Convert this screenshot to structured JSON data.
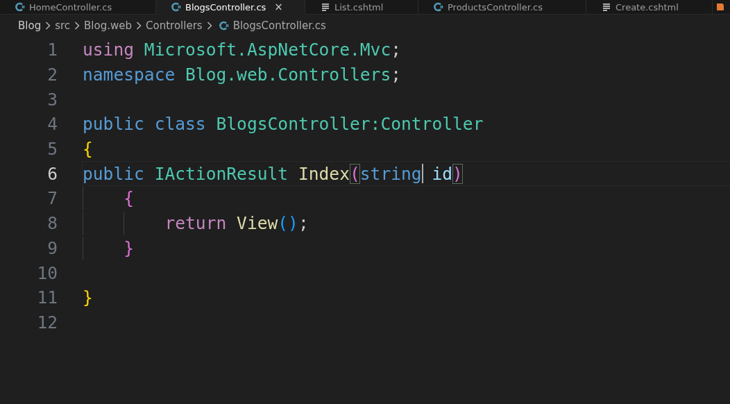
{
  "tabs": [
    {
      "label": "HomeController.cs",
      "kind": "csharp",
      "selected": false
    },
    {
      "label": "BlogsController.cs",
      "kind": "csharp",
      "selected": true,
      "close": "×"
    },
    {
      "label": "List.cshtml",
      "kind": "markup",
      "selected": false
    },
    {
      "label": "ProductsController.cs",
      "kind": "csharp",
      "selected": false
    },
    {
      "label": "Create.cshtml",
      "kind": "markup",
      "selected": false
    },
    {
      "kind": "other",
      "selected": false
    }
  ],
  "breadcrumb": [
    {
      "label": "Blog",
      "kind": "folder"
    },
    {
      "label": "src",
      "kind": "folder"
    },
    {
      "label": "Blog.web",
      "kind": "folder"
    },
    {
      "label": "Controllers",
      "kind": "folder"
    },
    {
      "label": "BlogsController.cs",
      "kind": "csharp"
    }
  ],
  "lines": [
    {
      "number": "1",
      "current": false,
      "tokens": [
        {
          "kind": "control",
          "text": "using"
        },
        {
          "kind": "type",
          "text": "Microsoft.AspNetCore.Mvc",
          "space": true
        },
        {
          "kind": "plain",
          "text": ";"
        }
      ]
    },
    {
      "number": "2",
      "current": false,
      "tokens": [
        {
          "kind": "keyword",
          "text": "namespace"
        },
        {
          "kind": "type",
          "text": "Blog.web.Controllers",
          "space": true
        },
        {
          "kind": "plain",
          "text": ";"
        }
      ]
    },
    {
      "number": "3",
      "current": false
    },
    {
      "number": "4",
      "current": false,
      "tokens": [
        {
          "kind": "keyword",
          "text": "public class"
        },
        {
          "kind": "type",
          "text": "BlogsController:Controller",
          "space": true
        }
      ]
    },
    {
      "number": "5",
      "current": false,
      "tokens": [
        {
          "kind": "bracket1",
          "text": "{"
        }
      ]
    },
    {
      "number": "6",
      "current": true,
      "tokens": [
        {
          "kind": "keyword",
          "text": "public"
        },
        {
          "kind": "type",
          "text": "IActionResult",
          "space": true
        },
        {
          "kind": "function",
          "text": "Index",
          "space": true
        },
        {
          "kind": "bracket2",
          "text": "(",
          "matched": true
        },
        {
          "kind": "keyword",
          "text": "string",
          "cursor_after": true
        },
        {
          "kind": "param",
          "text": "id",
          "space": true
        },
        {
          "kind": "bracket2",
          "text": ")",
          "matched": true
        }
      ],
      "children": [
        {
          "number": "7",
          "current": false,
          "tokens": [
            {
              "kind": "bracket2",
              "text": "{"
            }
          ],
          "children": [
            {
              "number": "8",
              "current": false,
              "tokens": [
                {
                  "kind": "control",
                  "text": "return"
                },
                {
                  "kind": "function",
                  "text": "View",
                  "space": true
                },
                {
                  "kind": "bracket3",
                  "text": "()"
                },
                {
                  "kind": "plain",
                  "text": ";"
                }
              ]
            }
          ]
        },
        {
          "number": "9",
          "current": false,
          "tokens": [
            {
              "kind": "bracket2",
              "text": "}"
            }
          ]
        }
      ]
    },
    {
      "number": "10",
      "current": false
    },
    {
      "number": "11",
      "current": false,
      "tokens": [
        {
          "kind": "bracket1",
          "text": "}"
        }
      ]
    },
    {
      "number": "12",
      "current": false
    }
  ]
}
